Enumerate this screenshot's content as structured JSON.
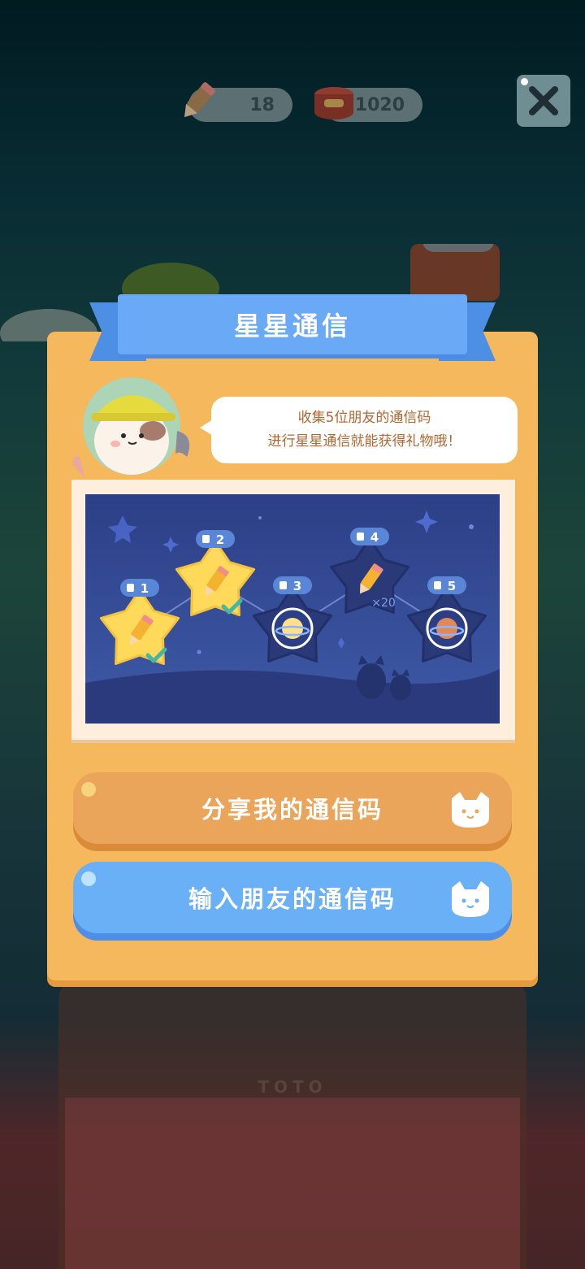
{
  "hud": {
    "pencils": "18",
    "cans": "1020"
  },
  "dialog": {
    "title": "星星通信",
    "message_line1": "收集5位朋友的通信码",
    "message_line2": "进行星星通信就能获得礼物哦！",
    "stars": [
      {
        "number": "1",
        "reward": "pencil-icon",
        "claimed": true
      },
      {
        "number": "2",
        "reward": "pencil-icon",
        "claimed": true
      },
      {
        "number": "3",
        "reward": "cat-planet-icon",
        "claimed": false
      },
      {
        "number": "4",
        "reward": "pencil-icon",
        "reward_count": "×20",
        "claimed": false
      },
      {
        "number": "5",
        "reward": "house-planet-icon",
        "claimed": false
      }
    ],
    "share_button": "分享我的通信码",
    "input_button": "输入朋友的通信码"
  },
  "background": {
    "sign": "TOTO"
  },
  "colors": {
    "panel": "#f6b85c",
    "ribbon": "#6aa9f6",
    "share_button": "#eba55a",
    "input_button": "#6ab0f7",
    "star_claimed": "#ffd95a",
    "star_locked": "#2a3a78"
  }
}
